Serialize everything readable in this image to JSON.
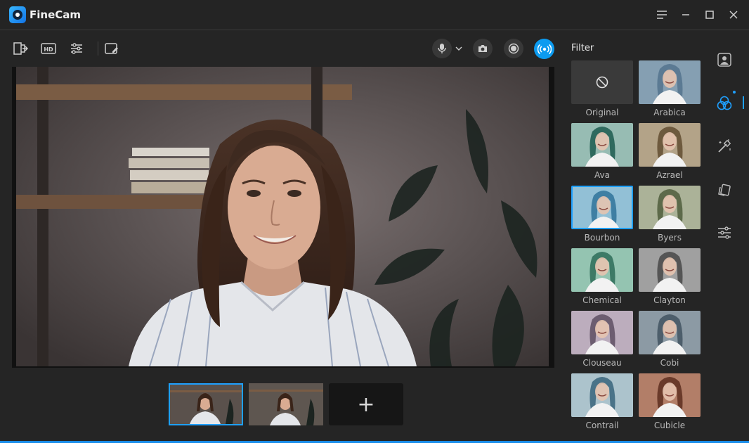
{
  "app": {
    "title": "FineCam"
  },
  "filter_panel": {
    "title": "Filter",
    "filters": [
      {
        "label": "Original"
      },
      {
        "label": "Arabica"
      },
      {
        "label": "Ava"
      },
      {
        "label": "Azrael"
      },
      {
        "label": "Bourbon"
      },
      {
        "label": "Byers"
      },
      {
        "label": "Chemical"
      },
      {
        "label": "Clayton"
      },
      {
        "label": "Clouseau"
      },
      {
        "label": "Cobi"
      },
      {
        "label": "Contrail"
      },
      {
        "label": "Cubicle"
      }
    ],
    "selected": "Bourbon"
  },
  "scenes": {
    "add_label": "+"
  },
  "colors": {
    "accent": "#1fa0ff",
    "live": "#0c9bf0",
    "background": "#252525"
  }
}
